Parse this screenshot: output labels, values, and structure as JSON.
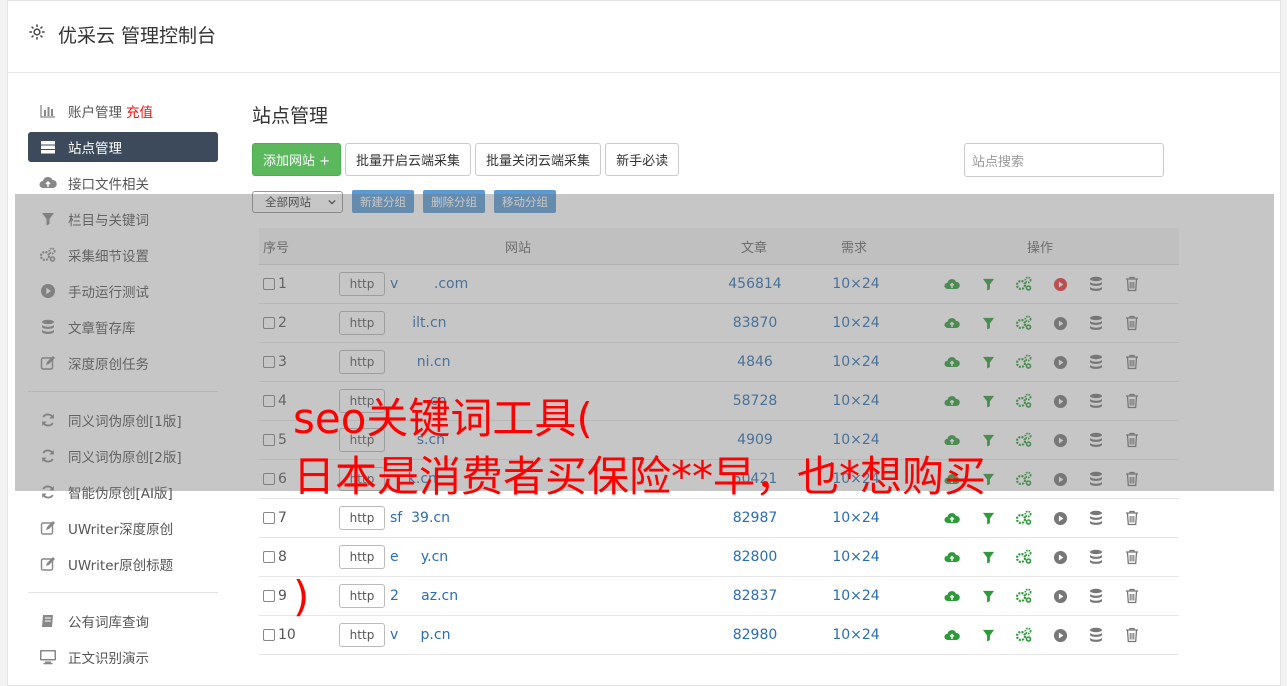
{
  "app": {
    "title": "优采云 管理控制台"
  },
  "sidebar": {
    "groups": [
      [
        {
          "label": "账户管理",
          "badge": "充值",
          "icon": "bar-chart-icon"
        },
        {
          "label": "站点管理",
          "icon": "server-icon",
          "active": true
        },
        {
          "label": "接口文件相关",
          "icon": "cloud-upload-icon"
        },
        {
          "label": "栏目与关键词",
          "icon": "filter-icon"
        },
        {
          "label": "采集细节设置",
          "icon": "gears-icon"
        },
        {
          "label": "手动运行测试",
          "icon": "play-circle-icon"
        },
        {
          "label": "文章暂存库",
          "icon": "database-icon"
        },
        {
          "label": "深度原创任务",
          "icon": "edit-icon"
        }
      ],
      [
        {
          "label": "同义词伪原创[1版]",
          "icon": "refresh-icon"
        },
        {
          "label": "同义词伪原创[2版]",
          "icon": "refresh-icon"
        },
        {
          "label": "智能伪原创[AI版]",
          "icon": "refresh-icon"
        },
        {
          "label": "UWriter深度原创",
          "icon": "edit-icon"
        },
        {
          "label": "UWriter原创标题",
          "icon": "edit-icon"
        }
      ],
      [
        {
          "label": "公有词库查询",
          "icon": "book-icon"
        },
        {
          "label": "正文识别演示",
          "icon": "monitor-icon"
        }
      ]
    ]
  },
  "main": {
    "title": "站点管理",
    "add_button": "添加网站 +",
    "batch_open": "批量开启云端采集",
    "batch_close": "批量关闭云端采集",
    "newbie": "新手必读",
    "search_placeholder": "站点搜索",
    "group_select": "全部网站",
    "new_group": "新建分组",
    "delete_group": "删除分组",
    "move_group": "移动分组"
  },
  "table": {
    "headers": {
      "no": "序号",
      "site": "网站",
      "articles": "文章",
      "demand": "需求",
      "ops": "操作"
    },
    "rows": [
      {
        "no": "1",
        "proto": "http",
        "domain": "v        .com",
        "articles": "456814",
        "demand": "10×24",
        "running": true
      },
      {
        "no": "2",
        "proto": "http",
        "domain": "     ilt.cn",
        "articles": "83870",
        "demand": "10×24",
        "running": false
      },
      {
        "no": "3",
        "proto": "http",
        "domain": "      ni.cn",
        "articles": "4846",
        "demand": "10×24",
        "running": false
      },
      {
        "no": "4",
        "proto": "http",
        "domain": "        .cn",
        "articles": "58728",
        "demand": "10×24",
        "running": false
      },
      {
        "no": "5",
        "proto": "http",
        "domain": "      s.cn",
        "articles": "4909",
        "demand": "10×24",
        "running": false
      },
      {
        "no": "6",
        "proto": "http",
        "domain": "    k.cn",
        "articles": "50421",
        "demand": "10×24",
        "running": false
      },
      {
        "no": "7",
        "proto": "http",
        "domain": "sf  39.cn",
        "articles": "82987",
        "demand": "10×24",
        "running": false
      },
      {
        "no": "8",
        "proto": "http",
        "domain": "e     y.cn",
        "articles": "82800",
        "demand": "10×24",
        "running": false
      },
      {
        "no": "9",
        "proto": "http",
        "domain": "2     az.cn",
        "articles": "82837",
        "demand": "10×24",
        "running": false
      },
      {
        "no": "10",
        "proto": "http",
        "domain": "v     p.cn",
        "articles": "82980",
        "demand": "10×24",
        "running": false
      }
    ]
  },
  "overlay_text": {
    "line1": "seo关键词工具(",
    "line2": "日本是消费者买保险**早，也*想购买",
    "line3": ")"
  },
  "colors": {
    "accent": "#3d4a5c",
    "green": "#5cb85c",
    "link": "#2a6db0",
    "overlay_text": "#ff0000",
    "play_red": "#e33"
  }
}
